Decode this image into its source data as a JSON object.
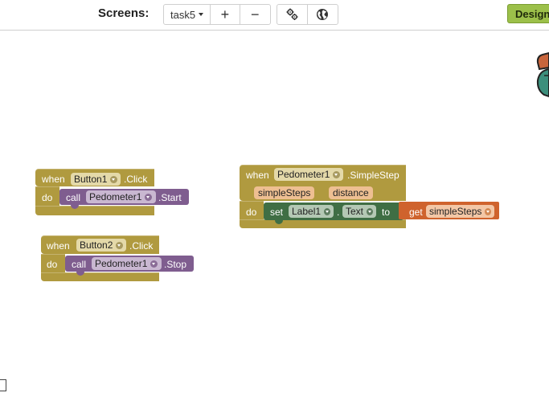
{
  "toolbar": {
    "screens_label": "Screens:",
    "current_screen": "task5",
    "add_screen_symbol": "+",
    "remove_screen_symbol": "−",
    "settings_icon": "gear-icon",
    "language_icon": "globe-icon",
    "designer_label": "Designer"
  },
  "blocks": {
    "button1_click": {
      "when": "when",
      "component": "Button1",
      "event": ".Click",
      "do": "do",
      "call": "call",
      "target": "Pedometer1",
      "method": ".Start"
    },
    "button2_click": {
      "when": "when",
      "component": "Button2",
      "event": ".Click",
      "do": "do",
      "call": "call",
      "target": "Pedometer1",
      "method": ".Stop"
    },
    "simplestep": {
      "when": "when",
      "component": "Pedometer1",
      "event": ".SimpleStep",
      "params": [
        "simpleSteps",
        "distance"
      ],
      "do": "do",
      "set": "set",
      "set_component": "Label1",
      "dot": ".",
      "property": "Text",
      "to": "to",
      "get": "get",
      "get_var": "simpleSteps"
    }
  },
  "colors": {
    "event_block": "#b09a3f",
    "component_call": "#7f5d8f",
    "setter_block": "#3f6e44",
    "variable_block": "#cf632d",
    "designer_button": "#9cc04a"
  }
}
